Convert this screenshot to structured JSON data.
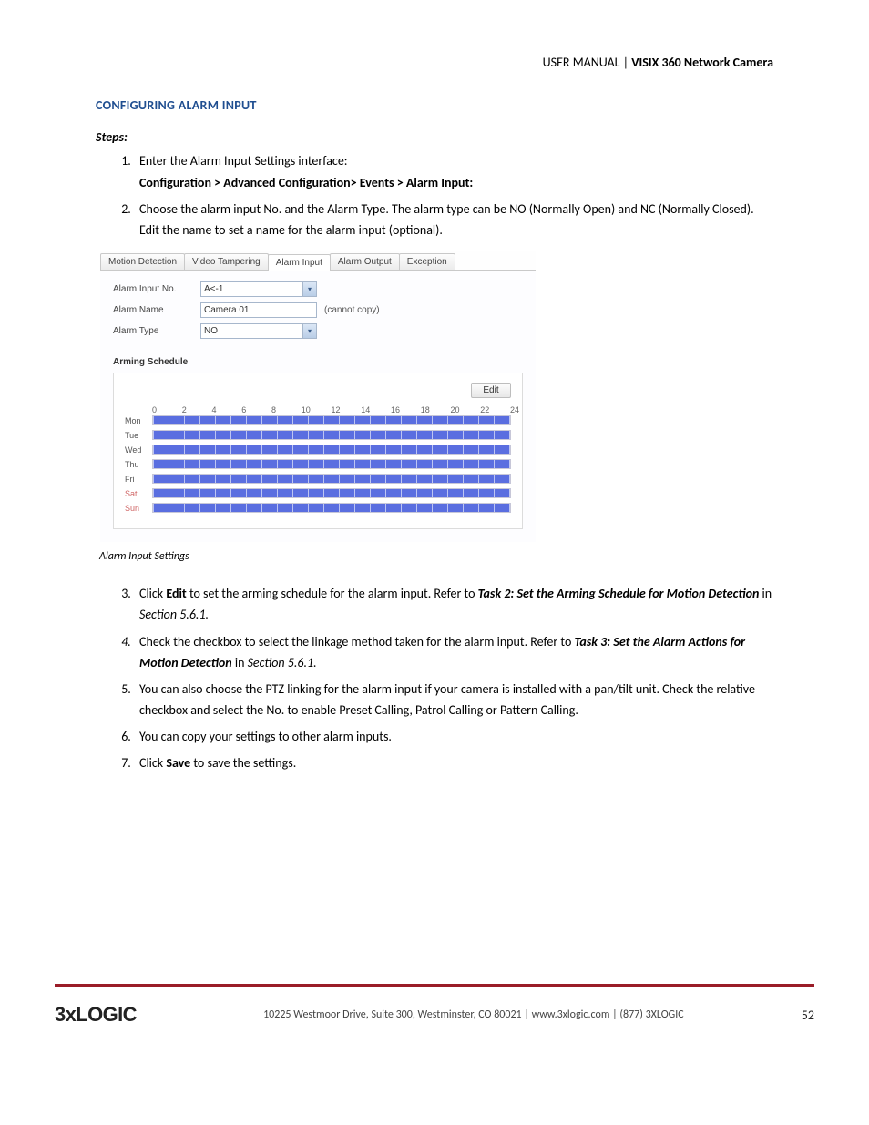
{
  "header": {
    "prefix": "USER MANUAL | ",
    "product": "VISIX 360 Network Camera"
  },
  "section_title": "CONFIGURING ALARM INPUT",
  "steps_heading": "Steps:",
  "steps": {
    "s1a": "Enter the Alarm Input Settings interface:",
    "s1b": "Configuration > Advanced Configuration> Events > Alarm Input:",
    "s2": "Choose the alarm input No. and the Alarm Type. The alarm type can be NO (Normally Open) and NC (Normally Closed). Edit the name to set a name for the alarm input (optional).",
    "s3a": "Click ",
    "s3b": "Edit",
    "s3c": " to set the arming schedule for the alarm input. Refer to ",
    "s3task": "Task 2: Set the Arming Schedule for Motion Detection",
    "s3d": " in ",
    "s3sec": "Section 5.6.1.",
    "s4a": "Check the checkbox to select the linkage method taken for the alarm input. Refer to ",
    "s4task": "Task 3: Set the Alarm Actions for Motion Detection",
    "s4b": " in ",
    "s4sec": "Section 5.6.1.",
    "s5": "You can also choose the PTZ linking for the alarm input if your camera is installed with a pan/tilt unit. Check the relative checkbox and select the No. to enable Preset Calling, Patrol Calling or Pattern Calling.",
    "s6": "You can copy your settings to other alarm inputs.",
    "s7a": "Click ",
    "s7b": "Save",
    "s7c": " to save the settings."
  },
  "caption": "Alarm Input Settings",
  "ui": {
    "tabs": [
      "Motion Detection",
      "Video Tampering",
      "Alarm Input",
      "Alarm Output",
      "Exception"
    ],
    "active_tab_index": 2,
    "fields": {
      "alarm_input_no_label": "Alarm Input No.",
      "alarm_input_no_value": "A<-1",
      "alarm_name_label": "Alarm Name",
      "alarm_name_value": "Camera 01",
      "alarm_name_hint": "(cannot copy)",
      "alarm_type_label": "Alarm Type",
      "alarm_type_value": "NO"
    },
    "schedule": {
      "title": "Arming Schedule",
      "edit": "Edit",
      "hours": [
        "0",
        "2",
        "4",
        "6",
        "8",
        "10",
        "12",
        "14",
        "16",
        "18",
        "20",
        "22",
        "24"
      ],
      "days": [
        "Mon",
        "Tue",
        "Wed",
        "Thu",
        "Fri",
        "Sat",
        "Sun"
      ]
    }
  },
  "footer": {
    "logo": "3xLOGIC",
    "address": "10225 Westmoor Drive, Suite 300, Westminster, CO 80021 | www.3xlogic.com | (877) 3XLOGIC",
    "page": "52"
  }
}
